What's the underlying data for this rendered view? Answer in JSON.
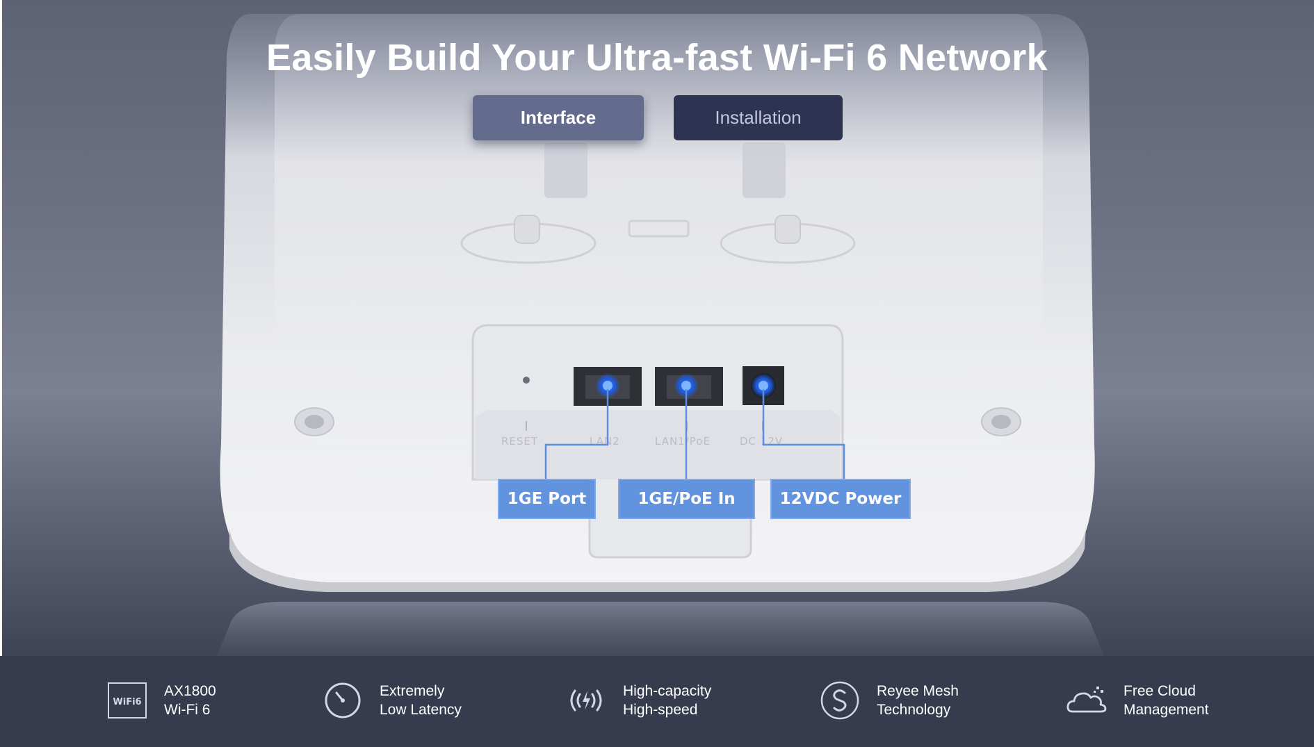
{
  "page": {
    "headline": "Easily Build Your Ultra-fast Wi-Fi 6 Network"
  },
  "tabs": {
    "interface_label": "Interface",
    "installation_label": "Installation",
    "active": "Interface"
  },
  "device": {
    "panel_prints": [
      "RESET",
      "LAN2",
      "LAN1/PoE",
      "DC 12V"
    ],
    "port_labels": [
      "1GE Port",
      "1GE/PoE In",
      "12VDC Power"
    ]
  },
  "features": [
    {
      "icon": "wifi6-icon",
      "badge": "WiFi6",
      "line1": "AX1800",
      "line2": "Wi-Fi 6"
    },
    {
      "icon": "gauge-icon",
      "line1": "Extremely",
      "line2": "Low Latency"
    },
    {
      "icon": "signal-bolt-icon",
      "line1": "High-capacity",
      "line2": "High-speed"
    },
    {
      "icon": "mesh-icon",
      "line1": "Reyee Mesh",
      "line2": "Technology"
    },
    {
      "icon": "cloud-icon",
      "line1": "Free Cloud",
      "line2": "Management"
    }
  ],
  "colors": {
    "label_blue": "#5b8fde",
    "active_tab": "#646c8e",
    "inactive_tab": "#2e3352",
    "feature_bar": "#363b4d"
  }
}
